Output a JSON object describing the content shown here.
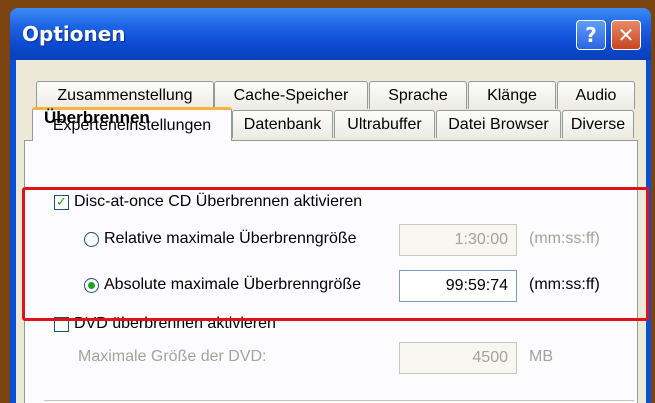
{
  "window": {
    "title": "Optionen"
  },
  "titlebar_buttons": {
    "help": "?",
    "close": "✕"
  },
  "tabs_row1": [
    "Zusammenstellung",
    "Cache-Speicher",
    "Sprache",
    "Klänge",
    "Audio"
  ],
  "tabs_row2": [
    "Experteneinstellungen",
    "Datenbank",
    "Ultrabuffer",
    "Datei Browser",
    "Diverse"
  ],
  "active_tab": "Experteneinstellungen",
  "section": {
    "heading": "Überbrennen",
    "dao_checkbox": {
      "label": "Disc-at-once CD Überbrennen aktivieren",
      "checked": true
    },
    "relative_radio": {
      "label": "Relative maximale Überbrenngröße",
      "selected": false,
      "value": "1:30:00",
      "unit": "(mm:ss:ff)"
    },
    "absolute_radio": {
      "label": "Absolute maximale Überbrenngröße",
      "selected": true,
      "value": "99:59:74",
      "unit": "(mm:ss:ff)"
    },
    "dvd_checkbox": {
      "label": "DVD überbrennen aktivieren",
      "checked": false
    },
    "dvd_max": {
      "label": "Maximale Größe der DVD:",
      "value": "4500",
      "unit": "MB"
    }
  },
  "colors": {
    "highlight": "#e0121b",
    "titlebar": "#0a4fd6",
    "check": "#21a121"
  }
}
